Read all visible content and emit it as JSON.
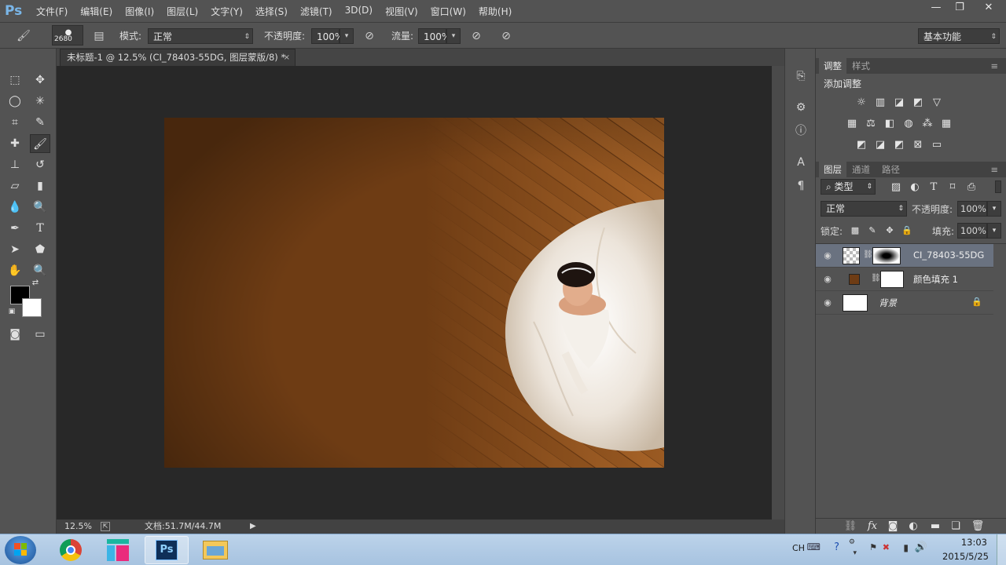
{
  "app": {
    "logo": "Ps",
    "menu": [
      "文件(F)",
      "编辑(E)",
      "图像(I)",
      "图层(L)",
      "文字(Y)",
      "选择(S)",
      "滤镜(T)",
      "3D(D)",
      "视图(V)",
      "窗口(W)",
      "帮助(H)"
    ],
    "window_controls": {
      "minimize": "—",
      "restore": "❐",
      "close": "✕"
    }
  },
  "options": {
    "brush_size": "2680",
    "mode_label": "模式:",
    "mode_value": "正常",
    "opacity_label": "不透明度:",
    "opacity_value": "100%",
    "flow_label": "流量:",
    "flow_value": "100%",
    "workspace": "基本功能"
  },
  "document": {
    "tab_title": "未标题-1 @ 12.5% (CI_78403-55DG, 图层蒙版/8) *",
    "tab_close": "×",
    "background_color": "#6e3c14"
  },
  "status": {
    "zoom": "12.5%",
    "doc_size": "文档:51.7M/44.7M"
  },
  "adjustments": {
    "tabs": [
      "调整",
      "样式"
    ],
    "heading": "添加调整"
  },
  "layers": {
    "tabs": [
      "图层",
      "通道",
      "路径"
    ],
    "filter_label": "类型",
    "blend_mode": "正常",
    "opacity_label": "不透明度:",
    "opacity_value": "100%",
    "lock_label": "锁定:",
    "fill_label": "填充:",
    "fill_value": "100%",
    "items": [
      {
        "name": "CI_78403-55DG",
        "selected": true
      },
      {
        "name": "颜色填充 1",
        "selected": false
      },
      {
        "name": "背景",
        "selected": false
      }
    ]
  },
  "taskbar": {
    "language": "CH",
    "time": "13:03",
    "date": "2015/5/25",
    "apps": [
      "chrome-icon",
      "app-icon",
      "photoshop-icon",
      "file-explorer-icon"
    ]
  }
}
